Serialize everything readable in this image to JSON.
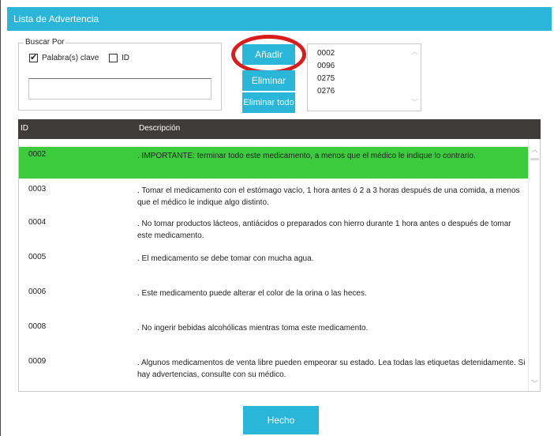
{
  "window": {
    "title": "Lista de Advertencia"
  },
  "search": {
    "group_label": "Buscar Por",
    "keywords_label": "Palabra(s) clave",
    "keywords_checked": true,
    "id_label": "ID",
    "id_checked": false,
    "query_value": "",
    "query_placeholder": ""
  },
  "actions": {
    "add_label": "Añadir",
    "remove_label": "Eliminar",
    "remove_all_label": "Eliminar todo",
    "done_label": "Hecho"
  },
  "added_ids": [
    "0002",
    "0096",
    "0275",
    "0276"
  ],
  "table": {
    "columns": {
      "id": "ID",
      "description": "Descripción"
    },
    "rows": [
      {
        "id": "0002",
        "description": ". IMPORTANTE: terminar todo este medicamento, a menos que el médico le indique lo contrario.",
        "selected": true
      },
      {
        "id": "0003",
        "description": ". Tomar el medicamento con el estómago vacío, 1 hora antes ó 2 a 3 horas después de una comida, a menos que el médico le indique algo distinto.",
        "selected": false
      },
      {
        "id": "0004",
        "description": ". No tomar productos lácteos, antiácidos o preparados con hierro durante 1 hora antes o después de tomar este medicamento.",
        "selected": false
      },
      {
        "id": "0005",
        "description": ". El medicamento se debe tomar con mucha agua.",
        "selected": false
      },
      {
        "id": "0006",
        "description": ". Este medicamento puede alterar el color de la orina o las heces.",
        "selected": false
      },
      {
        "id": "0008",
        "description": ". No ingerir bebidas alcohólicas mientras toma este medicamento.",
        "selected": false
      },
      {
        "id": "0009",
        "description": ". Algunos medicamentos de venta libre pueden empeorar su estado. Lea todas las etiquetas detenidamente. Si hay advertencias, consulte con su médico.",
        "selected": false
      }
    ]
  },
  "colors": {
    "accent": "#29b6d8",
    "header_bg": "#3f3b3a",
    "selected_row": "#3ccb3d",
    "highlight_ring": "#d91d1d"
  },
  "icons": {
    "checkbox_checked": "check-icon",
    "scroll_up": "chevron-up-icon",
    "scroll_down": "chevron-down-icon"
  }
}
